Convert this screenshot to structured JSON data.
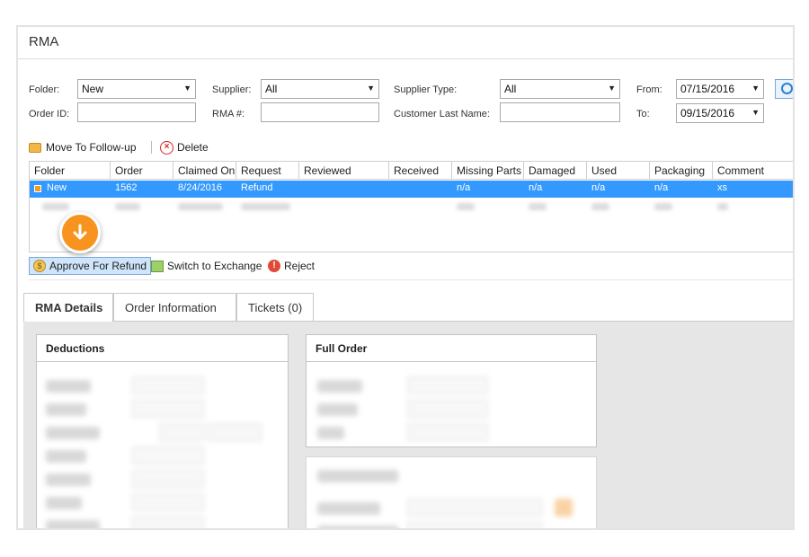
{
  "window": {
    "title": "RMA"
  },
  "filters": {
    "folder_label": "Folder:",
    "folder_value": "New",
    "supplier_label": "Supplier:",
    "supplier_value": "All",
    "supplier_type_label": "Supplier Type:",
    "supplier_type_value": "All",
    "from_label": "From:",
    "from_value": "07/15/2016",
    "order_id_label": "Order ID:",
    "order_id_value": "",
    "rma_label": "RMA #:",
    "rma_value": "",
    "customer_last_name_label": "Customer Last Name:",
    "customer_last_name_value": "",
    "to_label": "To:",
    "to_value": "09/15/2016"
  },
  "toolbar": {
    "move_label": "Move To Follow-up",
    "delete_label": "Delete"
  },
  "grid": {
    "columns": [
      "Folder",
      "Order",
      "Claimed On",
      "Request",
      "Reviewed",
      "Received",
      "Missing Parts",
      "Damaged",
      "Used",
      "Packaging",
      "Comment"
    ],
    "rows": [
      {
        "folder": "New",
        "order": "1562",
        "claimed_on": "8/24/2016",
        "request": "Refund",
        "reviewed": "",
        "received": "",
        "missing_parts": "n/a",
        "damaged": "n/a",
        "used": "n/a",
        "packaging": "n/a",
        "comment": "xs"
      }
    ]
  },
  "actions": {
    "approve_label": "Approve For Refund",
    "exchange_label": "Switch to Exchange",
    "reject_label": "Reject"
  },
  "tabs": [
    {
      "label": "RMA Details",
      "active": true
    },
    {
      "label": "Order Information",
      "active": false
    },
    {
      "label": "Tickets (0)",
      "active": false
    }
  ],
  "panels": {
    "deductions_title": "Deductions",
    "full_order_title": "Full Order"
  },
  "colors": {
    "selected_row": "#3399ff",
    "callout": "#f7931e",
    "approve_highlight": "#cfe5fb"
  }
}
